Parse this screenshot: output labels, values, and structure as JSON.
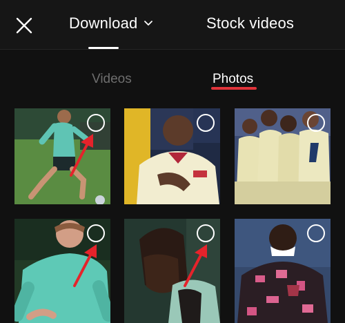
{
  "header": {
    "close_icon": "close-icon",
    "tabs": [
      {
        "label": "Download",
        "active": true,
        "icon": "chevron-down-icon"
      },
      {
        "label": "Stock videos",
        "active": false
      }
    ]
  },
  "subtabs": [
    {
      "label": "Videos",
      "active": false
    },
    {
      "label": "Photos",
      "active": true
    }
  ],
  "colors": {
    "background": "#111111",
    "accent": "#e0343a",
    "annotation_arrow": "#e5232b",
    "inactive_text": "#6e6e6e"
  },
  "photos": [
    {
      "selected": false,
      "annotated": true
    },
    {
      "selected": false,
      "annotated": false
    },
    {
      "selected": false,
      "annotated": false
    },
    {
      "selected": false,
      "annotated": true
    },
    {
      "selected": false,
      "annotated": true
    },
    {
      "selected": false,
      "annotated": false
    }
  ]
}
